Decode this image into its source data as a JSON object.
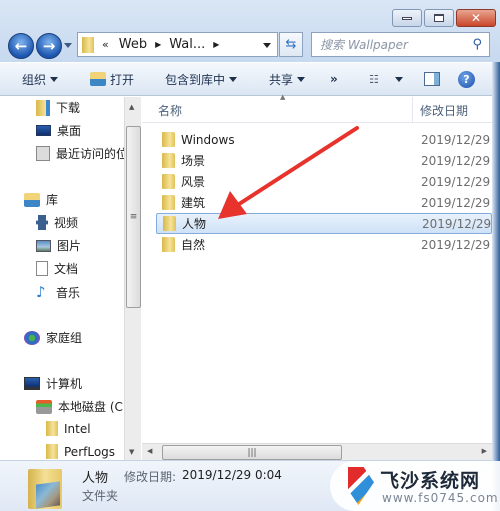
{
  "window": {
    "controls": {
      "minimize": "minimize",
      "maximize": "maximize",
      "close": "close"
    }
  },
  "nav": {
    "back_icon": "back-arrow-icon",
    "forward_icon": "forward-arrow-icon"
  },
  "address": {
    "overflow": "«",
    "crumbs": [
      "Web",
      "Wal..."
    ]
  },
  "search": {
    "placeholder": "搜索 Wallpaper"
  },
  "toolbar": {
    "organize": "组织",
    "open": "打开",
    "include_in_library": "包含到库中",
    "share": "共享",
    "more": "»"
  },
  "sidebar": {
    "items": [
      {
        "label": "下载",
        "icon": "downloads-icon"
      },
      {
        "label": "桌面",
        "icon": "desktop-icon"
      },
      {
        "label": "最近访问的位",
        "icon": "recent-places-icon"
      },
      {
        "label": "库",
        "icon": "library-icon"
      },
      {
        "label": "视频",
        "icon": "videos-icon"
      },
      {
        "label": "图片",
        "icon": "pictures-icon"
      },
      {
        "label": "文档",
        "icon": "documents-icon"
      },
      {
        "label": "音乐",
        "icon": "music-icon"
      },
      {
        "label": "家庭组",
        "icon": "homegroup-icon"
      },
      {
        "label": "计算机",
        "icon": "computer-icon"
      },
      {
        "label": "本地磁盘 (C:",
        "icon": "local-disk-icon"
      },
      {
        "label": "Intel",
        "icon": "folder-icon"
      },
      {
        "label": "PerfLogs",
        "icon": "folder-icon"
      }
    ]
  },
  "columns": {
    "name": "名称",
    "modified": "修改日期"
  },
  "files": [
    {
      "name": "Windows",
      "date": "2019/12/29"
    },
    {
      "name": "场景",
      "date": "2019/12/29"
    },
    {
      "name": "风景",
      "date": "2019/12/29"
    },
    {
      "name": "建筑",
      "date": "2019/12/29"
    },
    {
      "name": "人物",
      "date": "2019/12/29",
      "selected": true
    },
    {
      "name": "自然",
      "date": "2019/12/29"
    }
  ],
  "details": {
    "name": "人物",
    "modified_label": "修改日期:",
    "modified_value": "2019/12/29 0:04",
    "type": "文件夹"
  },
  "watermark": {
    "title": "飞沙系统网",
    "url": "www.fs0745.com"
  },
  "colors": {
    "annotation_arrow": "#e8322c",
    "selection": "#cfe2f7"
  }
}
